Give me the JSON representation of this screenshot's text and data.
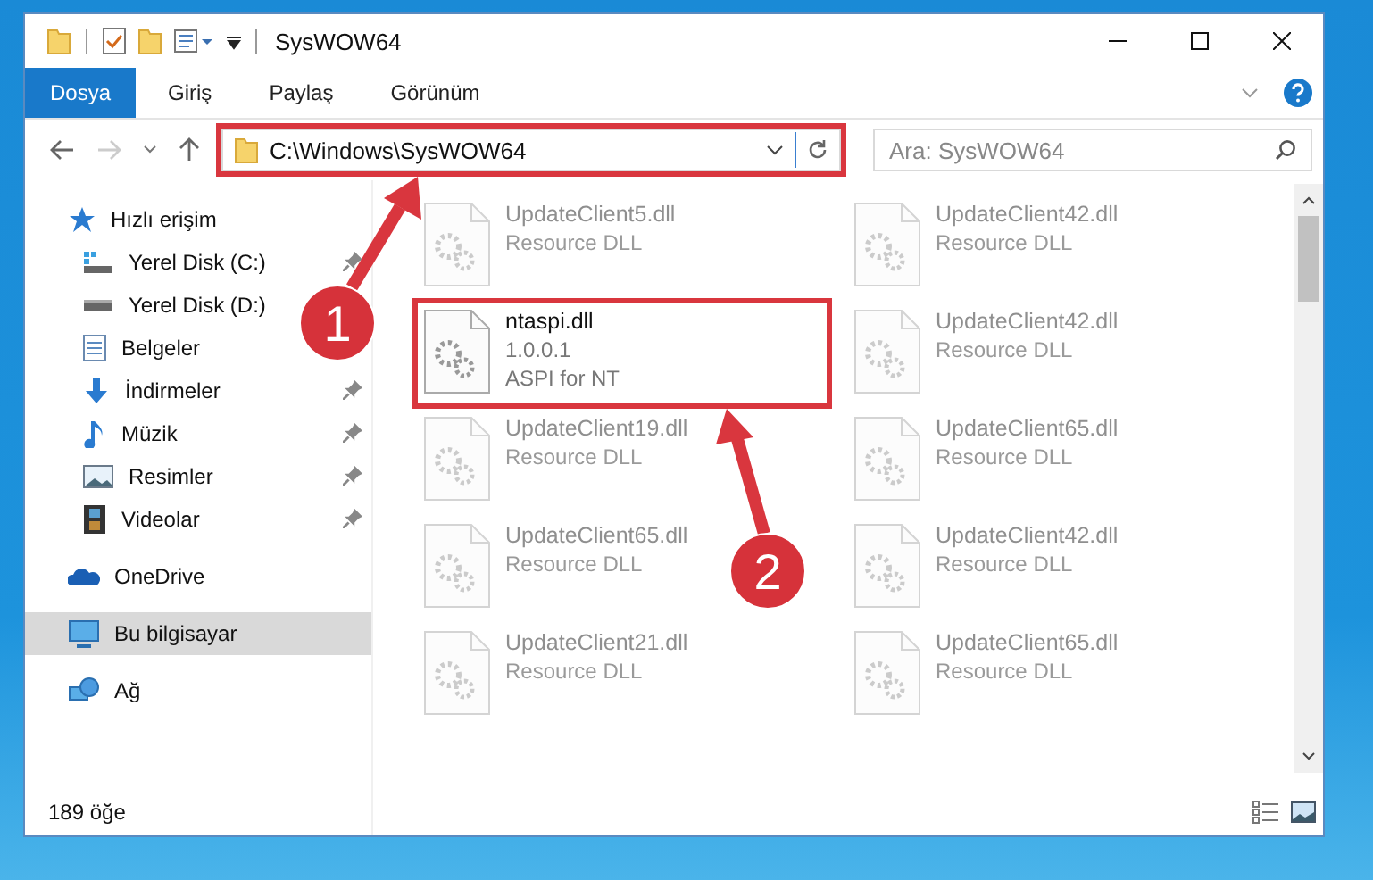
{
  "window": {
    "title": "SysWOW64"
  },
  "ribbon_tabs": [
    {
      "label": "Dosya",
      "selected": true
    },
    {
      "label": "Giriş",
      "selected": false
    },
    {
      "label": "Paylaş",
      "selected": false
    },
    {
      "label": "Görünüm",
      "selected": false
    }
  ],
  "address": {
    "path": "C:\\Windows\\SysWOW64",
    "highlighted": true
  },
  "search": {
    "placeholder": "Ara: SysWOW64"
  },
  "sidebar": {
    "items": [
      {
        "label": "Hızlı erişim",
        "kind": "star",
        "selected": false,
        "children": [
          {
            "label": "Yerel Disk (C:)",
            "kind": "disk-c",
            "pinned": true,
            "selected": false
          },
          {
            "label": "Yerel Disk (D:)",
            "kind": "disk",
            "selected": false
          },
          {
            "label": "Belgeler",
            "kind": "documents",
            "selected": false
          },
          {
            "label": "İndirmeler",
            "kind": "downloads",
            "pinned": true,
            "selected": false
          },
          {
            "label": "Müzik",
            "kind": "music",
            "pinned": true,
            "selected": false
          },
          {
            "label": "Resimler",
            "kind": "pictures",
            "pinned": true,
            "selected": false
          },
          {
            "label": "Videolar",
            "kind": "videos",
            "pinned": true,
            "selected": false
          }
        ]
      },
      {
        "label": "OneDrive",
        "kind": "cloud",
        "selected": false
      },
      {
        "label": "Bu bilgisayar",
        "kind": "computer",
        "selected": true
      },
      {
        "label": "Ağ",
        "kind": "network",
        "selected": false
      }
    ]
  },
  "files": [
    {
      "name": "UpdateClient5.dll",
      "lines": [
        "Resource DLL"
      ],
      "faded": true,
      "highlighted": false
    },
    {
      "name": "UpdateClient42.dll",
      "lines": [
        "Resource DLL"
      ],
      "faded": true,
      "highlighted": false
    },
    {
      "name": "ntaspi.dll",
      "lines": [
        "1.0.0.1",
        "ASPI for NT"
      ],
      "faded": false,
      "highlighted": true
    },
    {
      "name": "UpdateClient42.dll",
      "lines": [
        "Resource DLL"
      ],
      "faded": true,
      "highlighted": false
    },
    {
      "name": "UpdateClient19.dll",
      "lines": [
        "Resource DLL"
      ],
      "faded": true,
      "highlighted": false
    },
    {
      "name": "UpdateClient65.dll",
      "lines": [
        "Resource DLL"
      ],
      "faded": true,
      "highlighted": false
    },
    {
      "name": "UpdateClient65.dll",
      "lines": [
        "Resource DLL"
      ],
      "faded": true,
      "highlighted": false
    },
    {
      "name": "UpdateClient42.dll",
      "lines": [
        "Resource DLL"
      ],
      "faded": true,
      "highlighted": false
    },
    {
      "name": "UpdateClient21.dll",
      "lines": [
        "Resource DLL"
      ],
      "faded": true,
      "highlighted": false
    },
    {
      "name": "UpdateClient65.dll",
      "lines": [
        "Resource DLL"
      ],
      "faded": true,
      "highlighted": false
    }
  ],
  "status_bar": {
    "item_count": "189 öğe"
  },
  "annotations": [
    {
      "number": "1"
    },
    {
      "number": "2"
    }
  ]
}
